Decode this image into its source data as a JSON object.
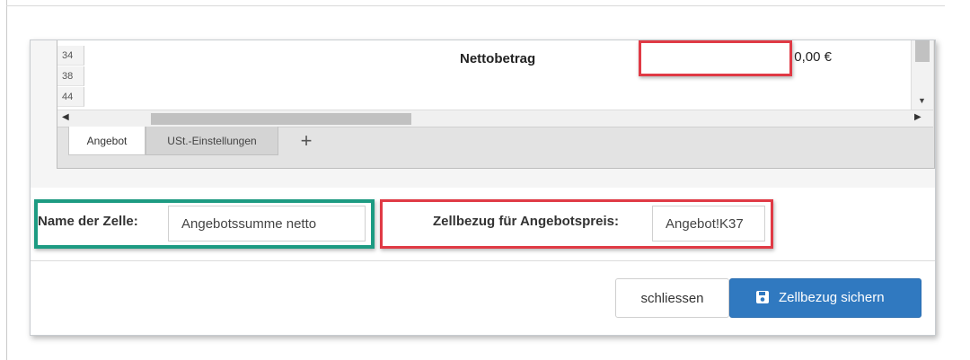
{
  "spreadsheet": {
    "row_numbers": [
      "34",
      "38",
      "44"
    ],
    "cell_label": "Nettobetrag",
    "cell_value": "0,00 €",
    "tabs": [
      "Angebot",
      "USt.-Einstellungen"
    ],
    "add_tab_symbol": "+"
  },
  "form": {
    "cell_name_label": "Name der Zelle:",
    "cell_name_value": "Angebotssumme netto",
    "cell_ref_label": "Zellbezug für Angebotspreis:",
    "cell_ref_value": "Angebot!K37"
  },
  "buttons": {
    "close_label": "schliessen",
    "save_label": "Zellbezug sichern"
  },
  "colors": {
    "highlight_red": "#e03a45",
    "highlight_green": "#1d9b82",
    "primary_button": "#3079c0"
  },
  "icons": {
    "save": "floppy-disk-icon",
    "vscroll_down": "arrow-down-icon",
    "hscroll_left": "arrow-left-icon",
    "hscroll_right": "arrow-right-icon",
    "add_tab": "plus-icon"
  }
}
